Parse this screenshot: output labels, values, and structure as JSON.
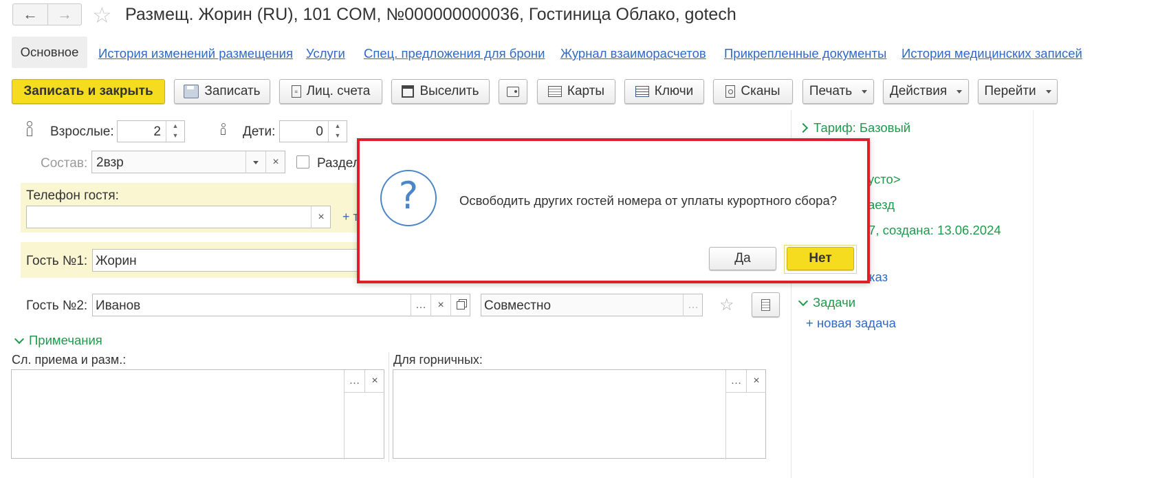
{
  "title": "Размещ. Жорин (RU), 101 COM, №000000000036, Гостиница Облако, gotech",
  "tabs": [
    "Основное",
    "История изменений размещения",
    "Услуги",
    "Спец. предложения для брони",
    "Журнал взаиморасчетов",
    "Прикрепленные документы",
    "История медицинских записей"
  ],
  "toolbar": {
    "save_close": "Записать и закрыть",
    "save": "Записать",
    "accounts": "Лиц. счета",
    "checkout": "Выселить",
    "cards": "Карты",
    "keys": "Ключи",
    "scans": "Сканы",
    "print": "Печать",
    "actions": "Действия",
    "goto": "Перейти"
  },
  "form": {
    "adults_label": "Взрослые:",
    "adults_value": "2",
    "children_label": "Дети:",
    "children_value": "0",
    "composition_label": "Состав:",
    "composition_value": "2взр",
    "separate_label": "Раздел",
    "phone_label": "Телефон гостя:",
    "phone_value": "",
    "phone_add": "+ т",
    "guest1_label": "Гость №1:",
    "guest1_value": "Жорин",
    "guest2_label": "Гость №2:",
    "guest2_value": "Иванов",
    "together_placeholder": "Совместно",
    "notes_header": "Примечания",
    "reception_label": "Сл. приема и разм.:",
    "maids_label": "Для горничных:"
  },
  "sidebar": {
    "tariff": "Тариф: Базовый",
    "empty": "усто>",
    "arrival": "аезд",
    "created": "7, создана: 13.06.2024",
    "order": "каз",
    "tasks_header": "Задачи",
    "new_task": "+ новая задача"
  },
  "dialog": {
    "question": "Освободить других гостей номера от уплаты курортного сбора?",
    "yes": "Да",
    "no": "Нет"
  },
  "colors": {
    "accent_yellow": "#f5dc1e",
    "link_blue": "#2f6ac5",
    "green": "#1e9a4a",
    "dialog_border": "#e01e2a",
    "highlight_bg": "#fbf6d2"
  }
}
